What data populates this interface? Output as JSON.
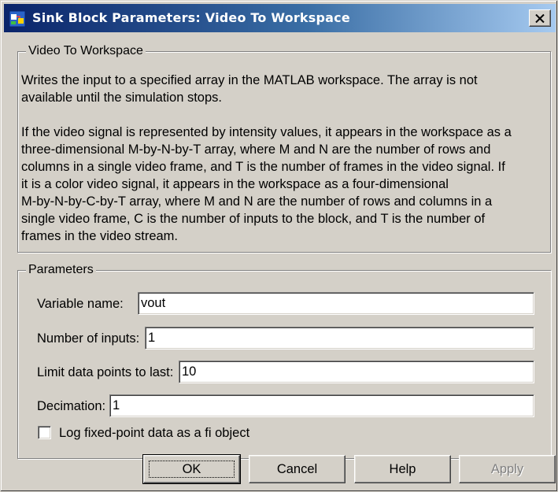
{
  "window": {
    "title": "Sink Block Parameters: Video To Workspace",
    "icon": "simulink-block-icon",
    "close_label": "✕"
  },
  "description_group": {
    "title": "Video To Workspace",
    "lines": [
      "Writes the input to a specified array in the MATLAB workspace. The array is not",
      "available until the simulation stops.",
      "",
      "If the video signal is represented by intensity values, it appears in the workspace as a",
      "three-dimensional M-by-N-by-T array, where M and N are the number of rows and",
      "columns in a single video frame, and T is the number of frames in the video signal. If",
      "it is a color video signal, it appears in the workspace as a four-dimensional",
      "M-by-N-by-C-by-T array, where M and N are the number of rows and columns in a",
      "single video frame, C is the number of inputs to the block, and T is the number of",
      "frames in the video stream."
    ]
  },
  "parameters_group": {
    "title": "Parameters",
    "variable_name": {
      "label": "Variable name:",
      "value": "vout"
    },
    "number_of_inputs": {
      "label": "Number of inputs:",
      "value": "1"
    },
    "limit_data_points": {
      "label": "Limit data points to last:",
      "value": "10"
    },
    "decimation": {
      "label": "Decimation:",
      "value": "1"
    },
    "log_fixed_point": {
      "label": "Log fixed-point data as a fi object",
      "checked": false
    }
  },
  "buttons": {
    "ok": "OK",
    "cancel": "Cancel",
    "help": "Help",
    "apply": "Apply"
  },
  "colors": {
    "dialog_face": "#d4d0c8",
    "titlebar_start": "#0a246a",
    "titlebar_end": "#a6caf0",
    "disabled_text": "#808080"
  }
}
